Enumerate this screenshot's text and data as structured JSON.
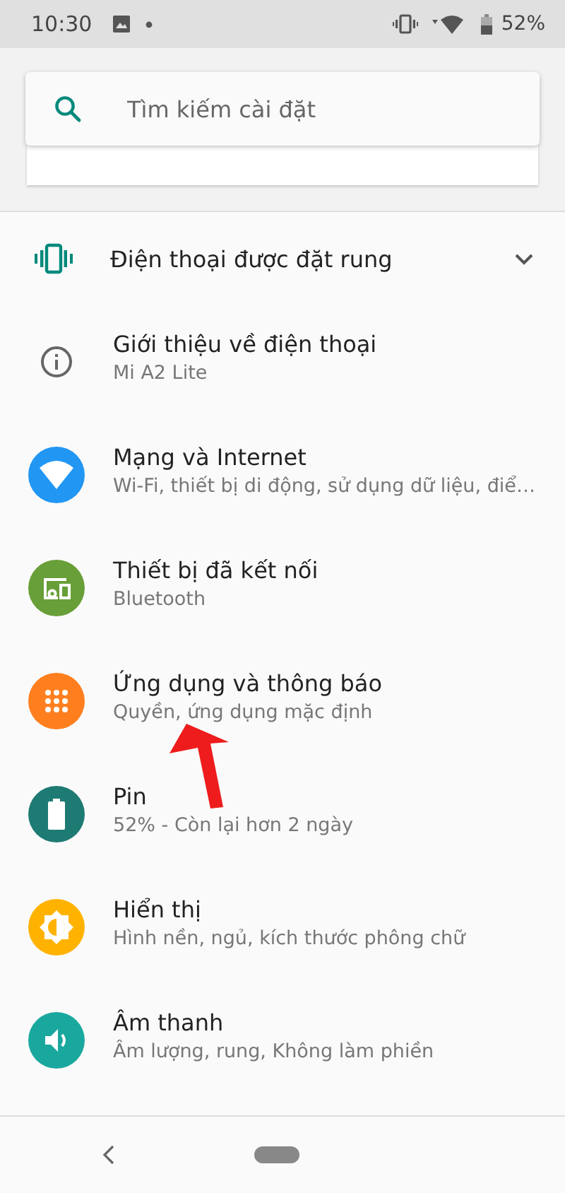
{
  "status_bar": {
    "time": "10:30",
    "battery": "52%"
  },
  "search": {
    "placeholder": "Tìm kiếm cài đặt"
  },
  "condition": {
    "title": "Điện thoại được đặt rung",
    "expanded": false
  },
  "settings": [
    {
      "title": "Giới thiệu về điện thoại",
      "subtitle": "Mi A2 Lite"
    },
    {
      "title": "Mạng và Internet",
      "subtitle": "Wi-Fi, thiết bị di động, sử dụng dữ liệu, điể…",
      "color": "#2196f3"
    },
    {
      "title": "Thiết bị đã kết nối",
      "subtitle": "Bluetooth",
      "color": "#689f38"
    },
    {
      "title": "Ứng dụng và thông báo",
      "subtitle": "Quyền, ứng dụng mặc định",
      "color": "#ff7f1f"
    },
    {
      "title": "Pin",
      "subtitle": "52% - Còn lại hơn 2 ngày",
      "color": "#1e7b74"
    },
    {
      "title": "Hiển thị",
      "subtitle": "Hình nền, ngủ, kích thước phông chữ",
      "color": "#ffb300"
    },
    {
      "title": "Âm thanh",
      "subtitle": "Âm lượng, rung, Không làm phiền",
      "color": "#1aa89e"
    }
  ]
}
